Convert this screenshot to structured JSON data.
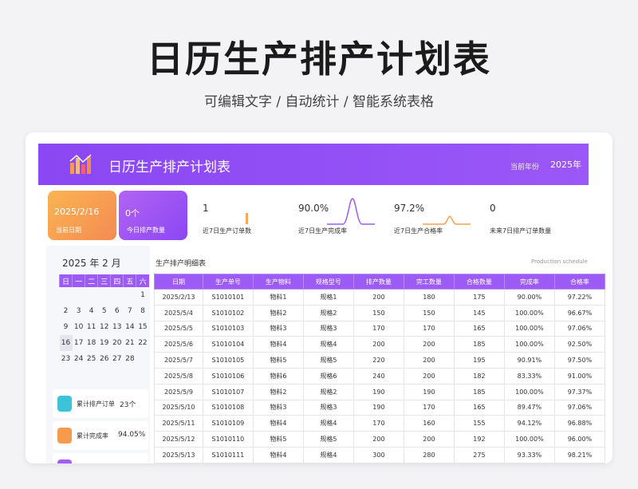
{
  "page": {
    "title": "日历生产排产计划表",
    "subtitle": "可编辑文字 / 自动统计 / 智能系统表格"
  },
  "banner": {
    "title": "日历生产排产计划表",
    "year_label": "当前年份",
    "year_value": "2025年",
    "accent": "#8a47f3",
    "logo_icon": "bar-chart-icon"
  },
  "kpis": {
    "current_date": {
      "value": "2025/2/16",
      "label": "当前日期"
    },
    "today_count": {
      "value": "0个",
      "label": "今日排产数量"
    },
    "stats": [
      {
        "value": "1",
        "label": "近7日生产订单数"
      },
      {
        "value": "90.0%",
        "label": "近7日生产完成率"
      },
      {
        "value": "97.2%",
        "label": "近7日生产合格率"
      },
      {
        "value": "0",
        "label": "未来7日排产订单数量"
      }
    ]
  },
  "calendar": {
    "header": "2025  年   2  月",
    "weekdays": [
      "日",
      "一",
      "二",
      "三",
      "四",
      "五",
      "六"
    ],
    "weeks": [
      [
        "",
        "",
        "",
        "",
        "",
        "",
        "1"
      ],
      [
        "2",
        "3",
        "4",
        "5",
        "6",
        "7",
        "8"
      ],
      [
        "9",
        "10",
        "11",
        "12",
        "13",
        "14",
        "15"
      ],
      [
        "16",
        "17",
        "18",
        "19",
        "20",
        "21",
        "22"
      ],
      [
        "23",
        "24",
        "25",
        "26",
        "27",
        "28",
        ""
      ]
    ],
    "today": "16"
  },
  "summary": [
    {
      "label": "累计排产订单",
      "value": "23个",
      "icon": "document-icon",
      "color": "#3cc3d9"
    },
    {
      "label": "累计完成率",
      "value": "94.05%",
      "icon": "chart-icon",
      "color": "#f69a4e"
    },
    {
      "label": "",
      "value": "",
      "icon": "check-icon",
      "color": "#a55ef5"
    }
  ],
  "detail": {
    "title": "生产排产明细表",
    "title_en": "Production schedule",
    "columns": [
      "日期",
      "生产单号",
      "生产物料",
      "规格型号",
      "排产数量",
      "完工数量",
      "合格数量",
      "完成率",
      "合格率"
    ],
    "rows": [
      [
        "2025/2/13",
        "S1010101",
        "物料1",
        "规格1",
        "200",
        "180",
        "175",
        "90.00%",
        "97.22%"
      ],
      [
        "2025/5/4",
        "S1010102",
        "物料2",
        "规格2",
        "150",
        "150",
        "145",
        "100.00%",
        "96.67%"
      ],
      [
        "2025/5/5",
        "S1010103",
        "物料3",
        "规格3",
        "170",
        "170",
        "165",
        "100.00%",
        "97.06%"
      ],
      [
        "2025/5/6",
        "S1010104",
        "物料4",
        "规格4",
        "200",
        "200",
        "185",
        "100.00%",
        "92.50%"
      ],
      [
        "2025/5/7",
        "S1010105",
        "物料5",
        "规格5",
        "220",
        "200",
        "195",
        "90.91%",
        "97.50%"
      ],
      [
        "2025/5/8",
        "S1010106",
        "物料6",
        "规格6",
        "240",
        "200",
        "182",
        "83.33%",
        "91.00%"
      ],
      [
        "2025/5/9",
        "S1010107",
        "物料2",
        "规格2",
        "190",
        "190",
        "185",
        "100.00%",
        "97.37%"
      ],
      [
        "2025/5/10",
        "S1010108",
        "物料3",
        "规格3",
        "190",
        "170",
        "165",
        "89.47%",
        "97.06%"
      ],
      [
        "2025/5/11",
        "S1010109",
        "物料4",
        "规格4",
        "170",
        "160",
        "155",
        "94.12%",
        "96.88%"
      ],
      [
        "2025/5/12",
        "S1010110",
        "物料5",
        "规格5",
        "200",
        "200",
        "192",
        "100.00%",
        "96.00%"
      ],
      [
        "2025/5/13",
        "S1010111",
        "物料4",
        "规格4",
        "300",
        "280",
        "275",
        "93.33%",
        "98.21%"
      ]
    ]
  }
}
